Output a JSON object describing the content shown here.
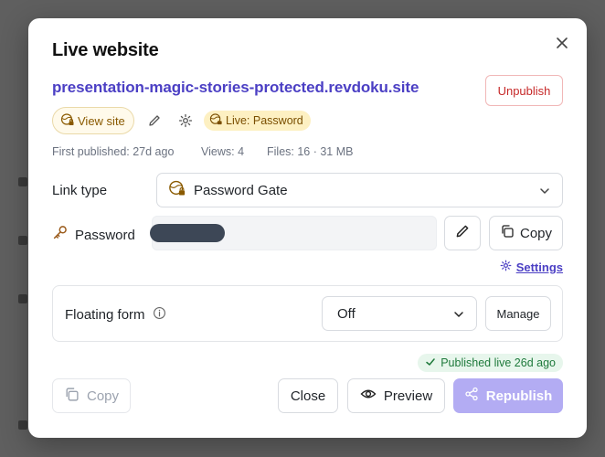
{
  "modal": {
    "title": "Live website",
    "site_url": "presentation-magic-stories-protected.revdoku.site",
    "unpublish_label": "Unpublish",
    "view_site_label": "View site",
    "live_badge_label": "Live: Password",
    "meta": {
      "first_published": "First published: 27d ago",
      "views": "Views: 4",
      "files": "Files: 16 · 31 MB"
    },
    "link_type": {
      "label": "Link type",
      "selected": "Password Gate"
    },
    "password": {
      "label": "Password",
      "copy_label": "Copy"
    },
    "settings_label": "Settings",
    "floating_form": {
      "label": "Floating form",
      "selected": "Off",
      "manage_label": "Manage"
    },
    "published_status": "Published live 26d ago",
    "footer": {
      "copy_label": "Copy",
      "close_label": "Close",
      "preview_label": "Preview",
      "republish_label": "Republish"
    }
  },
  "colors": {
    "accent": "#4b3fc4",
    "danger": "#c62828",
    "success": "#1f7a3c",
    "republish_bg": "#b3acf3",
    "live_badge_bg": "#fdf0c2"
  },
  "icons": [
    "close-icon",
    "globe-lock-icon",
    "pencil-icon",
    "gear-icon",
    "chevron-down-icon",
    "key-icon",
    "copy-icon",
    "info-icon",
    "check-icon",
    "eye-icon",
    "share-icon"
  ]
}
